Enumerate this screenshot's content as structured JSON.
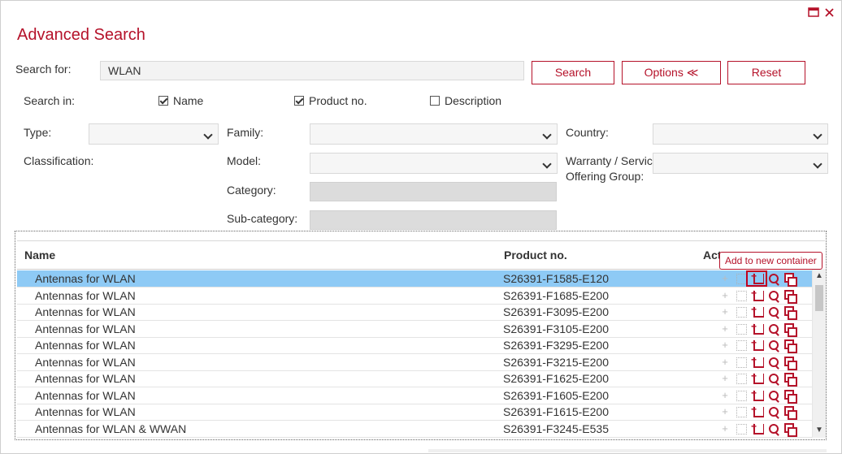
{
  "window": {
    "title": "Advanced Search",
    "maximize_icon": "maximize-icon",
    "close_icon": "close-icon"
  },
  "search": {
    "label": "Search for:",
    "value": "WLAN",
    "buttons": {
      "search": "Search",
      "options": "Options ≪",
      "reset": "Reset"
    }
  },
  "search_in": {
    "label": "Search in:",
    "options": [
      {
        "label": "Name",
        "checked": true
      },
      {
        "label": "Product no.",
        "checked": true
      },
      {
        "label": "Description",
        "checked": false
      }
    ]
  },
  "filters": {
    "type_label": "Type:",
    "family_label": "Family:",
    "country_label": "Country:",
    "classification_label": "Classification:",
    "model_label": "Model:",
    "warranty_label_line1": "Warranty / Service",
    "warranty_label_line2": "Offering Group:",
    "category_label": "Category:",
    "subcategory_label": "Sub-category:"
  },
  "results": {
    "columns": {
      "name": "Name",
      "product_no": "Product no.",
      "actions": "Act"
    },
    "rows": [
      {
        "name": "Antennas for WLAN",
        "product_no": "S26391-F1585-E120",
        "selected": true
      },
      {
        "name": "Antennas for WLAN",
        "product_no": "S26391-F1685-E200",
        "selected": false
      },
      {
        "name": "Antennas for WLAN",
        "product_no": "S26391-F3095-E200",
        "selected": false
      },
      {
        "name": "Antennas for WLAN",
        "product_no": "S26391-F3105-E200",
        "selected": false
      },
      {
        "name": "Antennas for WLAN",
        "product_no": "S26391-F3295-E200",
        "selected": false
      },
      {
        "name": "Antennas for WLAN",
        "product_no": "S26391-F3215-E200",
        "selected": false
      },
      {
        "name": "Antennas for WLAN",
        "product_no": "S26391-F1625-E200",
        "selected": false
      },
      {
        "name": "Antennas for WLAN",
        "product_no": "S26391-F1605-E200",
        "selected": false
      },
      {
        "name": "Antennas for WLAN",
        "product_no": "S26391-F1615-E200",
        "selected": false
      },
      {
        "name": "Antennas for WLAN & WWAN",
        "product_no": "S26391-F3245-E535",
        "selected": false
      }
    ]
  },
  "tooltip": {
    "text": "Add to new container"
  },
  "colors": {
    "accent": "#b5122a",
    "selected_row": "#8ecaf5"
  }
}
